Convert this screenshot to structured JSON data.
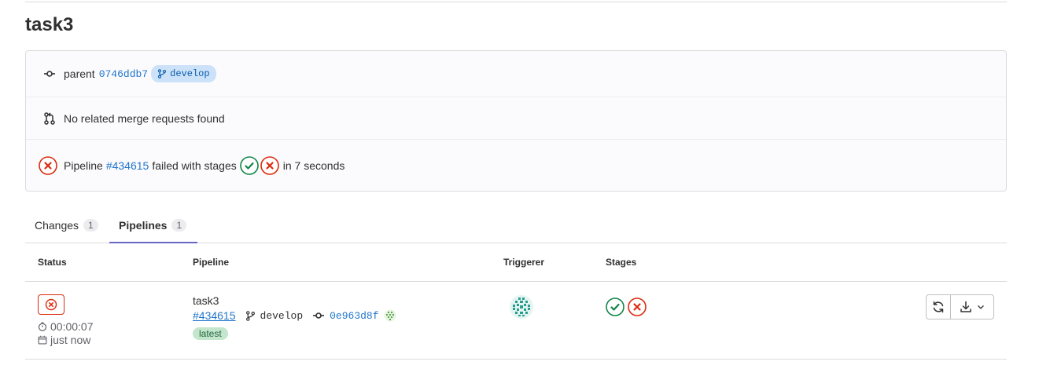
{
  "page": {
    "title": "task3"
  },
  "commit_info": {
    "parent_label": "parent",
    "parent_sha": "0746ddb7",
    "branch": "develop",
    "merge_requests_text": "No related merge requests found",
    "pipeline_prefix": "Pipeline",
    "pipeline_id": "#434615",
    "pipeline_status_text": "failed with stages",
    "pipeline_duration_text": "in 7 seconds"
  },
  "tabs": [
    {
      "label": "Changes",
      "count": "1"
    },
    {
      "label": "Pipelines",
      "count": "1"
    }
  ],
  "table": {
    "headers": {
      "status": "Status",
      "pipeline": "Pipeline",
      "triggerer": "Triggerer",
      "stages": "Stages"
    },
    "rows": [
      {
        "duration": "00:00:07",
        "finished": "just now",
        "name": "task3",
        "id": "#434615",
        "branch": "develop",
        "commit_sha": "0e963d8f",
        "tag": "latest"
      }
    ]
  },
  "colors": {
    "failed": "#dd2b0e",
    "success": "#108548",
    "link": "#1f75cb",
    "tab_active": "#6666c4"
  },
  "icons": [
    "commit-icon",
    "branch-icon",
    "merge-request-icon",
    "status-failed-icon",
    "status-success-icon",
    "timer-icon",
    "calendar-icon",
    "retry-icon",
    "download-icon",
    "chevron-down-icon"
  ]
}
